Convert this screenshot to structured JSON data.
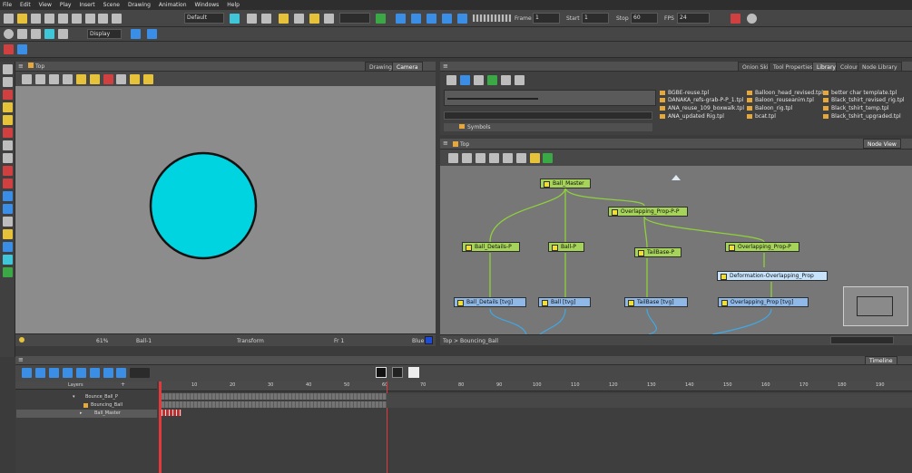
{
  "menu": [
    "File",
    "Edit",
    "View",
    "Play",
    "Insert",
    "Scene",
    "Drawing",
    "Animation",
    "Windows",
    "Help"
  ],
  "toolbar": {
    "workspace_value": "Default",
    "display_value": "Display",
    "frame_label": "Frame",
    "frame_value": "1",
    "start_label": "Start",
    "start_value": "1",
    "stop_label": "Stop",
    "stop_value": "60",
    "fps_label": "FPS",
    "fps_value": "24"
  },
  "camera_view": {
    "title": "Top",
    "tabs": [
      "Drawing",
      "Camera"
    ],
    "active_tab": "Camera",
    "circle_color": "#00d4e0",
    "footer": {
      "zoom": "61%",
      "drawing": "Ball-1",
      "transform": "Transform",
      "frame": "Fr 1",
      "color_name": "Blue",
      "color_hex": "#1d4bdc"
    }
  },
  "top_right_tabs": [
    "Onion Skin",
    "Tool Properties",
    "Library",
    "Colour",
    "Node Library"
  ],
  "active_right_tab": "Library",
  "library": {
    "symbols_label": "Symbols",
    "col1": [
      "BGBE-reuse.tpl",
      "DANAKA_refs-grab-P-P_1.tpl",
      "ANA_reuse_109_boxwalk.tpl",
      "ANA_updated Rig.tpl"
    ],
    "col2": [
      "Balloon_head_revised.tpl",
      "Baloon_reuseanim.tpl",
      "Baloon_rig.tpl",
      "bcat.tpl"
    ],
    "col3": [
      "better char template.tpl",
      "Black_tshirt_revised_rig.tpl",
      "Black_tshirt_temp.tpl",
      "Black_tshirt_upgraded.tpl"
    ]
  },
  "node_view": {
    "title": "Top",
    "tab": "Node View",
    "breadcrumb": [
      "Top",
      "Bouncing_Ball"
    ],
    "nodes": {
      "ball_master": "Ball_Master",
      "overlapping_ppp": "Overlapping_Prop-P-P",
      "ball_details_p": "Ball_Details-P",
      "ball_p": "Ball-P",
      "tailbase_p": "TailBase-P",
      "overlapping_p": "Overlapping_Prop-P",
      "deformation": "Deformation-Overlapping_Prop",
      "ball_details_tvg": "Ball_Details [tvg]",
      "ball_tvg": "Ball [tvg]",
      "tailbase_tvg": "TailBase [tvg]",
      "overlapping_tvg": "Overlapping_Prop [tvg]"
    }
  },
  "timeline": {
    "tab": "Timeline",
    "layers_label": "Layers",
    "layers": [
      "Bounce_Ball_P",
      "Bouncing_Ball",
      "Ball_Master"
    ],
    "frame_ticks": [
      "10",
      "20",
      "30",
      "40",
      "50",
      "60",
      "70",
      "80",
      "90",
      "100",
      "110",
      "120",
      "130",
      "140",
      "150",
      "160",
      "170",
      "180",
      "190"
    ]
  }
}
